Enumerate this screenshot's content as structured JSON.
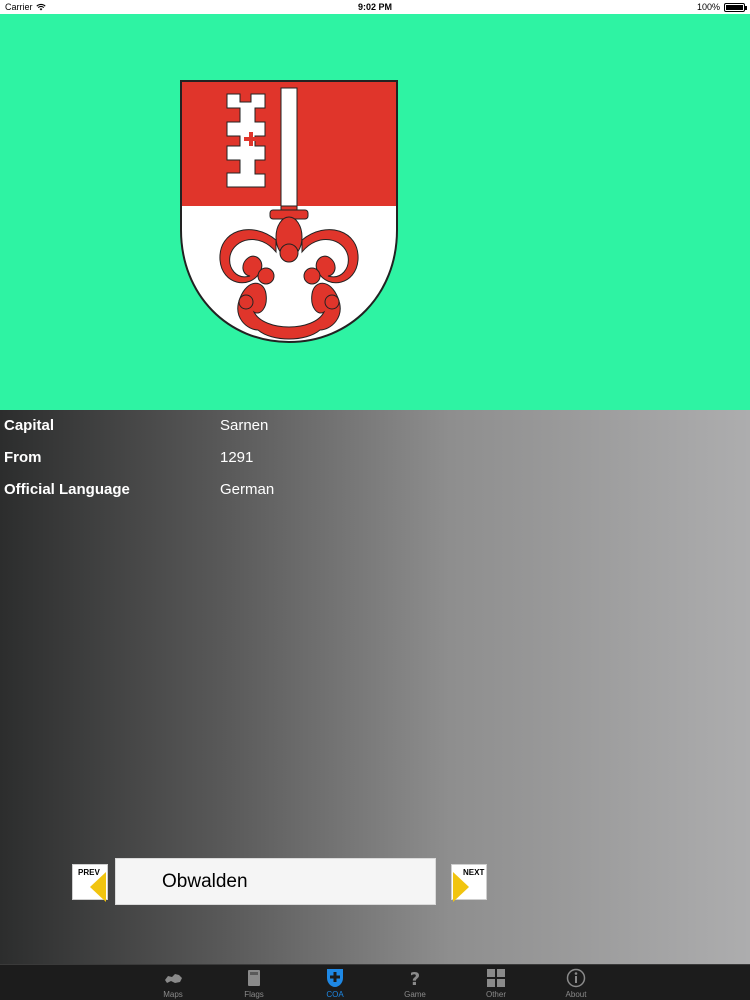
{
  "status_bar": {
    "carrier": "Carrier",
    "time": "9:02 PM",
    "battery": "100%"
  },
  "coat_of_arms": {
    "icon": "obwalden-coat-of-arms",
    "colors": {
      "background": "#2ef3a3",
      "red": "#e0352b",
      "white": "#ffffff"
    }
  },
  "info": [
    {
      "label": "Capital",
      "value": "Sarnen"
    },
    {
      "label": "From",
      "value": "1291"
    },
    {
      "label": "Official Language",
      "value": "German"
    }
  ],
  "navigation": {
    "prev_label": "PREV",
    "next_label": "NEXT",
    "canton_name": "Obwalden",
    "arrow_color": "#f1c40f"
  },
  "tabs": [
    {
      "label": "Maps",
      "icon": "switzerland-map-icon",
      "active": false
    },
    {
      "label": "Flags",
      "icon": "flag-book-icon",
      "active": false
    },
    {
      "label": "COA",
      "icon": "shield-cross-icon",
      "active": true
    },
    {
      "label": "Game",
      "icon": "question-mark-icon",
      "active": false
    },
    {
      "label": "Other",
      "icon": "grid-icon",
      "active": false
    },
    {
      "label": "About",
      "icon": "info-icon",
      "active": false
    }
  ],
  "accent_color": "#1e88e5"
}
